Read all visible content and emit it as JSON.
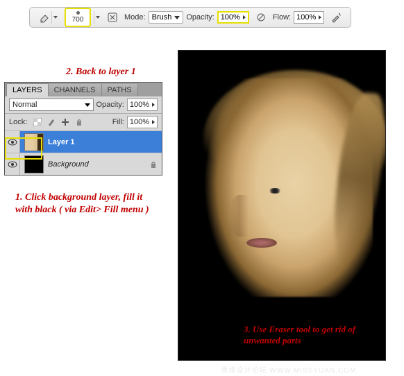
{
  "toolbar": {
    "brush_size": "700",
    "mode_label": "Mode:",
    "mode_value": "Brush",
    "opacity_label": "Opacity:",
    "opacity_value": "100%",
    "flow_label": "Flow:",
    "flow_value": "100%"
  },
  "annotations": {
    "step1": "1. Click background layer, fill it with black ( via Edit> Fill menu )",
    "step2": "2. Back to layer 1",
    "step3": "3. Use Eraser tool to get rid of unwanted parts"
  },
  "layers_panel": {
    "tabs": [
      "LAYERS",
      "CHANNELS",
      "PATHS"
    ],
    "blend_mode": "Normal",
    "opacity_label": "Opacity:",
    "opacity_value": "100%",
    "lock_label": "Lock:",
    "fill_label": "Fill:",
    "fill_value": "100%",
    "layers": [
      {
        "name": "Layer 1",
        "selected": true,
        "thumb": "portrait"
      },
      {
        "name": "Background",
        "selected": false,
        "thumb": "black"
      }
    ]
  },
  "watermark": "思缘设计论坛   WWW.MISSYUAN.COM"
}
